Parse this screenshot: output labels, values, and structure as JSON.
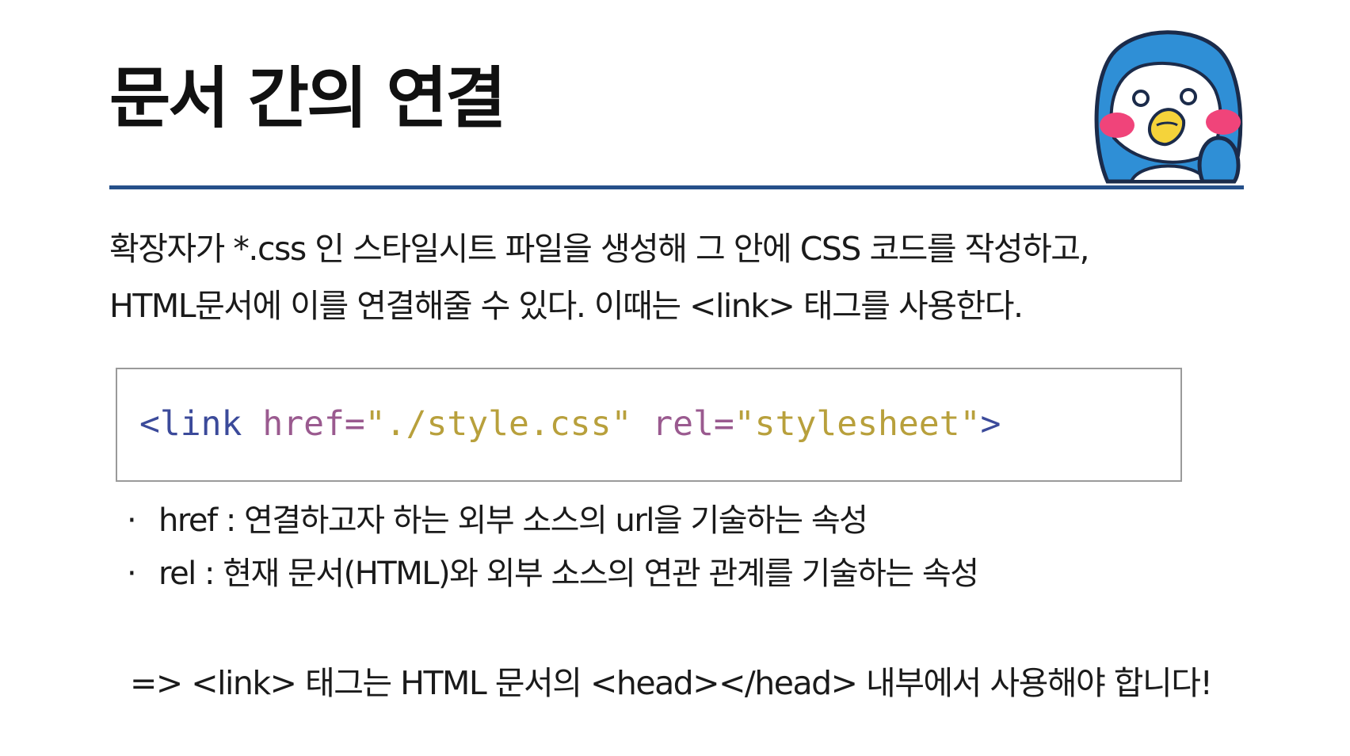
{
  "slide": {
    "title": "문서 간의 연결",
    "intro_lines": [
      "확장자가 *.css 인 스타일시트 파일을 생성해 그 안에 CSS 코드를 작성하고,",
      "HTML문서에 이를 연결해줄 수 있다. 이때는 <link> 태그를 사용한다."
    ],
    "code": {
      "tag_open": "<link",
      "attr1_name": "href",
      "attr1_eq": "=",
      "attr1_value": "\"./style.css\"",
      "attr2_name": "rel",
      "attr2_eq": "=",
      "attr2_value": "\"stylesheet\"",
      "tag_close": ">"
    },
    "bullet_dot": "·",
    "bullets": [
      "href : 연결하고자 하는 외부 소스의 url을 기술하는 속성",
      "rel : 현재 문서(HTML)와 외부 소스의 연관 관계를 기술하는 속성"
    ],
    "note": "=> <link> 태그는 HTML 문서의 <head></head> 내부에서 사용해야 합니다!"
  },
  "colors": {
    "title_rule": "#26508a",
    "code_tag": "#3b4a9a",
    "code_attr": "#9a5a8f",
    "code_string": "#b8a03c",
    "mascot_blue": "#2f8fd6",
    "mascot_cheek": "#f0447a",
    "mascot_beak": "#f5d33a"
  }
}
